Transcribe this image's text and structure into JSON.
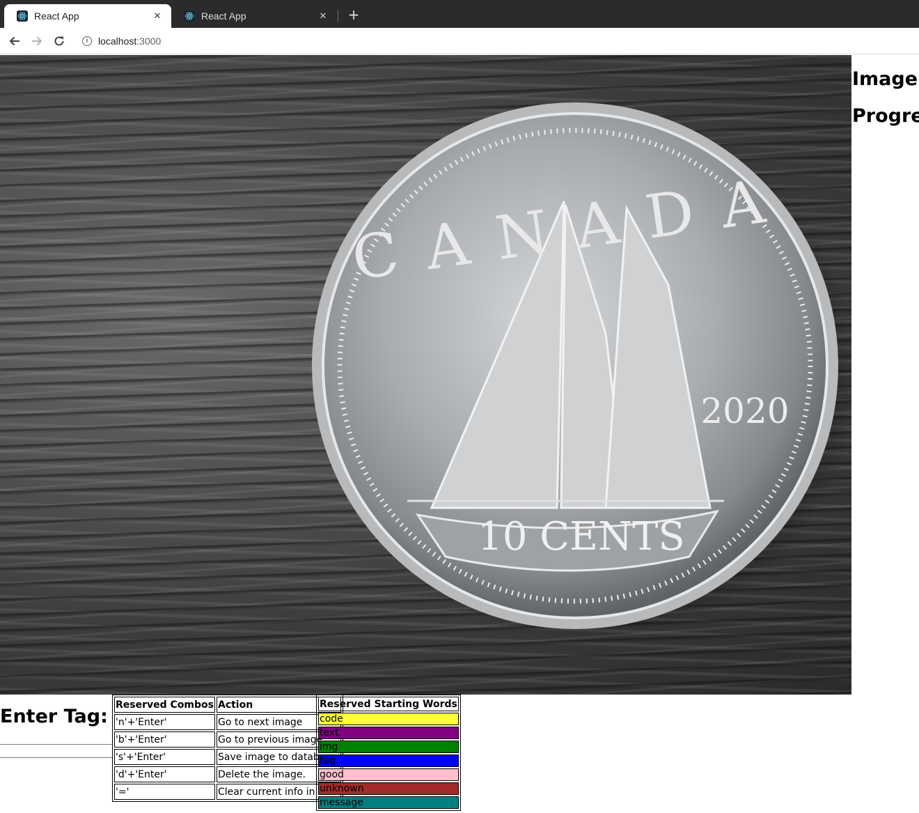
{
  "browser": {
    "tabs": [
      {
        "title": "React App",
        "active": true
      },
      {
        "title": "React App",
        "active": false
      }
    ],
    "url_host": "localhost",
    "url_port": ":3000"
  },
  "photo": {
    "coin": {
      "country": "CANADA",
      "year": "2020",
      "denomination": "10 CENTS"
    }
  },
  "sidebar": {
    "image_label": "Image:",
    "progress_label": "Progress"
  },
  "tag_entry": {
    "label": "Enter Tag:",
    "value": ""
  },
  "combos_table": {
    "headers": [
      "Reserved Combos",
      "Action"
    ],
    "rows": [
      {
        "combo": "'n'+'Enter'",
        "action": "Go to next image"
      },
      {
        "combo": "'b'+'Enter'",
        "action": "Go to previous image."
      },
      {
        "combo": "'s'+'Enter'",
        "action": "Save image to database."
      },
      {
        "combo": "'d'+'Enter'",
        "action": "Delete the image."
      },
      {
        "combo": "'='",
        "action": "Clear current info in bar"
      }
    ]
  },
  "words_table": {
    "header": "Reserved Starting Words",
    "rows": [
      {
        "word": "code",
        "color": "#ffff33"
      },
      {
        "word": "text",
        "color": "#800080"
      },
      {
        "word": "img",
        "color": "#008000"
      },
      {
        "word": "tag",
        "color": "#0000ff"
      },
      {
        "word": "good",
        "color": "#ffc0cb"
      },
      {
        "word": "unknown",
        "color": "#a52a2a"
      },
      {
        "word": "message",
        "color": "#008080"
      }
    ]
  }
}
